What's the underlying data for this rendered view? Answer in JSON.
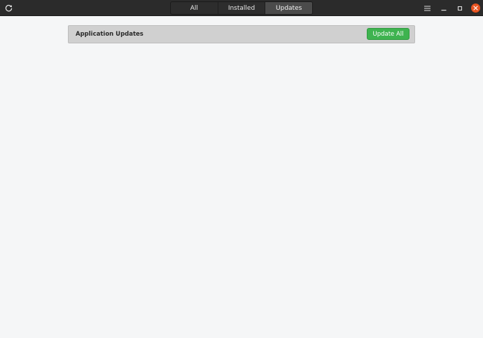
{
  "header": {
    "refresh_icon": "refresh-icon",
    "tabs": [
      {
        "label": "All",
        "active": false
      },
      {
        "label": "Installed",
        "active": false
      },
      {
        "label": "Updates",
        "active": true
      }
    ],
    "window_controls": {
      "menu_icon": "hamburger-menu-icon",
      "minimize_icon": "minimize-icon",
      "maximize_icon": "maximize-icon",
      "close_icon": "close-icon"
    }
  },
  "main": {
    "updates_panel": {
      "title": "Application Updates",
      "update_all_label": "Update All"
    }
  },
  "colors": {
    "headerbar": "#2b2b2b",
    "active_tab": "#4b4b4b",
    "background": "#f5f6f7",
    "panel": "#d0d0d0",
    "update_button": "#3eb34f",
    "close_button": "#e95420"
  }
}
